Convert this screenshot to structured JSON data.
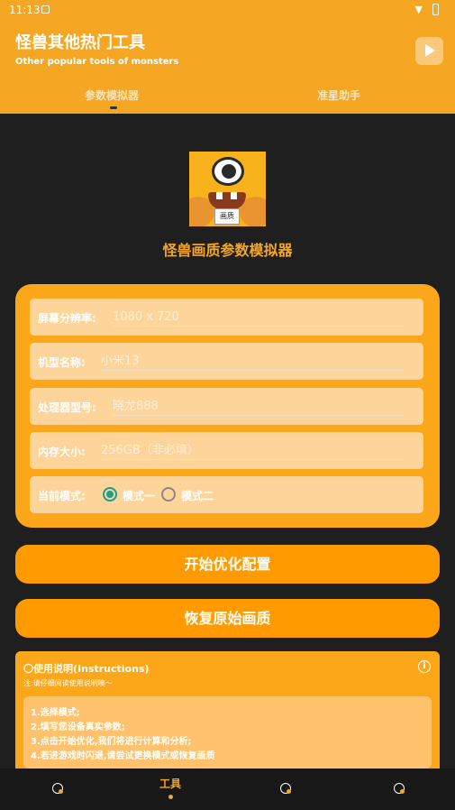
{
  "status_bar": {
    "time": "11:13"
  },
  "header": {
    "title": "怪兽其他热门工具",
    "subtitle": "Other popular tools of monsters"
  },
  "tabs": [
    {
      "label": "参数模拟器",
      "selected": true
    },
    {
      "label": "准星助手",
      "selected": false
    }
  ],
  "app": {
    "logo_text": "画质",
    "name": "怪兽画质参数模拟器"
  },
  "form": {
    "resolution": {
      "label": "屏幕分辨率:",
      "placeholder": "1080 x 720"
    },
    "model": {
      "label": "机型名称:",
      "placeholder": "小米13"
    },
    "processor": {
      "label": "处理器型号:",
      "placeholder": "晓龙888"
    },
    "memory": {
      "label": "内存大小:",
      "placeholder": "256GB（非必填）"
    },
    "mode": {
      "label": "当前模式:",
      "options": [
        "模式一",
        "模式二"
      ],
      "selected": "模式一"
    }
  },
  "buttons": {
    "start_optimize": "开始优化配置",
    "restore_quality": "恢复原始画质"
  },
  "instructions": {
    "title": "〇使用说明(Instructions)",
    "note": "注:请仔细阅读使用说明噢～",
    "steps": [
      "1.选择模式;",
      "2.填写您设备真实参数;",
      "3.点击开始优化,我们将进行计算和分析;",
      "4.若进游戏时闪退,请尝试更换模式或恢复画质"
    ]
  },
  "bottom_nav": {
    "items": [
      {
        "icon": "home-icon",
        "label": ""
      },
      {
        "icon": "tools-icon",
        "label": "工具",
        "selected": true
      },
      {
        "icon": "discover-icon",
        "label": ""
      },
      {
        "icon": "profile-icon",
        "label": ""
      }
    ]
  },
  "colors": {
    "accent": "#f5a623",
    "card": "#fca619",
    "button": "#ff9b00",
    "background": "#1f1f1f",
    "radio_checked": "#1aa08e"
  }
}
